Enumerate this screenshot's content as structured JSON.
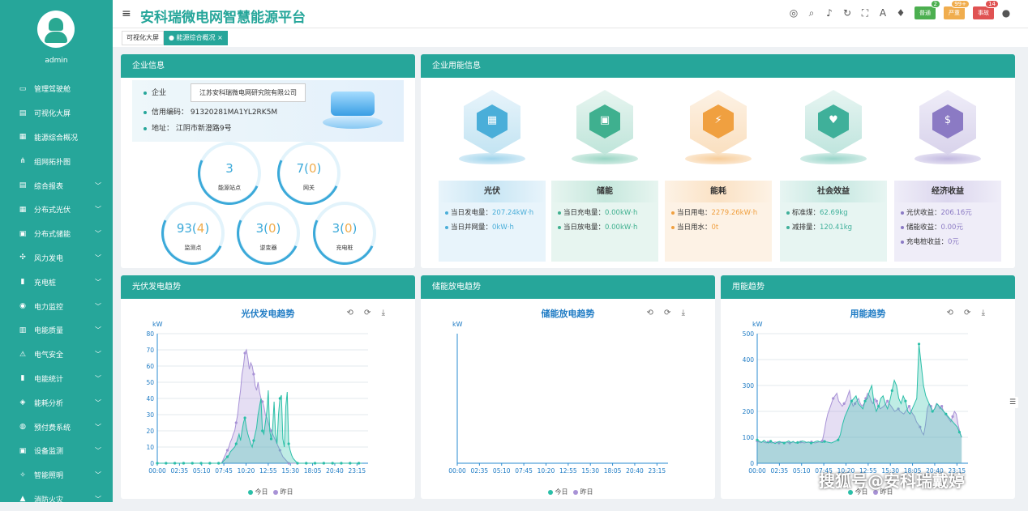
{
  "user": {
    "name": "admin"
  },
  "app": {
    "title": "安科瑞微电网智慧能源平台"
  },
  "menu": [
    {
      "label": "管理驾驶舱",
      "icon": "monitor-icon",
      "chev": false
    },
    {
      "label": "可视化大屏",
      "icon": "chart-icon",
      "chev": false
    },
    {
      "label": "能源综合概况",
      "icon": "grid-icon",
      "chev": false
    },
    {
      "label": "组网拓扑图",
      "icon": "topology-icon",
      "chev": false
    },
    {
      "label": "综合报表",
      "icon": "report-icon",
      "chev": true
    },
    {
      "label": "分布式光伏",
      "icon": "solar-icon",
      "chev": true
    },
    {
      "label": "分布式储能",
      "icon": "battery-icon",
      "chev": true
    },
    {
      "label": "风力发电",
      "icon": "wind-icon",
      "chev": true
    },
    {
      "label": "充电桩",
      "icon": "charger-icon",
      "chev": true
    },
    {
      "label": "电力监控",
      "icon": "power-icon",
      "chev": true
    },
    {
      "label": "电能质量",
      "icon": "quality-icon",
      "chev": true
    },
    {
      "label": "电气安全",
      "icon": "safety-icon",
      "chev": true
    },
    {
      "label": "电能统计",
      "icon": "stats-icon",
      "chev": true
    },
    {
      "label": "能耗分析",
      "icon": "analysis-icon",
      "chev": true
    },
    {
      "label": "预付费系统",
      "icon": "prepay-icon",
      "chev": true
    },
    {
      "label": "设备监测",
      "icon": "device-icon",
      "chev": true
    },
    {
      "label": "智能照明",
      "icon": "bulb-icon",
      "chev": true
    },
    {
      "label": "消防火灾",
      "icon": "fire-icon",
      "chev": true
    }
  ],
  "badges": [
    {
      "label": "普通",
      "count": "2",
      "color": "#4caf50"
    },
    {
      "label": "严重",
      "count": "99+",
      "color": "#f0ad4e"
    },
    {
      "label": "事故",
      "count": "14",
      "color": "#e05252"
    }
  ],
  "tabs": [
    {
      "label": "可视化大屏"
    },
    {
      "label": "● 能源综合概况 ×"
    }
  ],
  "enterprise": {
    "header": "企业信息",
    "company_label": "企业",
    "company": "江苏安科瑞微电网研究院有限公司",
    "credit": "信用编码：  91320281MA1YL2RK5M",
    "address": "地址：  江阴市新澄路9号",
    "stats": [
      {
        "value": "3",
        "extra": "",
        "label": "能源站点"
      },
      {
        "value": "7",
        "extra": "0",
        "label": "网关"
      },
      {
        "value": "93",
        "extra": "4",
        "label": "监测点"
      },
      {
        "value": "3",
        "extra": "0",
        "label": "逆变器"
      },
      {
        "value": "3",
        "extra": "0",
        "label": "充电桩"
      }
    ]
  },
  "energy_info": {
    "header": "企业用能信息",
    "cards": [
      {
        "title": "光伏",
        "color": "#4aaed9",
        "bg": "#e8f4fb",
        "rows": [
          {
            "k": "当日发电量：",
            "v": "207.24kW·h"
          },
          {
            "k": "当日并网量：",
            "v": "0kW·h"
          }
        ]
      },
      {
        "title": "储能",
        "color": "#3fb08f",
        "bg": "#e7f5f0",
        "rows": [
          {
            "k": "当日充电量：",
            "v": "0.00kW·h"
          },
          {
            "k": "当日放电量：",
            "v": "0.00kW·h"
          }
        ]
      },
      {
        "title": "能耗",
        "color": "#f0a040",
        "bg": "#fdf2e5",
        "rows": [
          {
            "k": "当日用电：",
            "v": "2279.26kW·h"
          },
          {
            "k": "当日用水：",
            "v": "0t"
          }
        ]
      },
      {
        "title": "社会效益",
        "color": "#3fb09a",
        "bg": "#e7f5f2",
        "rows": [
          {
            "k": "标准煤：",
            "v": "62.69kg"
          },
          {
            "k": "减排量：",
            "v": "120.41kg"
          }
        ]
      },
      {
        "title": "经济收益",
        "color": "#8b7ac4",
        "bg": "#efedf8",
        "rows": [
          {
            "k": "光伏收益：",
            "v": "206.16元"
          },
          {
            "k": "储能收益：",
            "v": "0.00元"
          },
          {
            "k": "充电桩收益：",
            "v": "0元"
          }
        ]
      }
    ]
  },
  "panels": {
    "pv": "光伏发电趋势",
    "es": "储能放电趋势",
    "use": "用能趋势"
  },
  "chart_tools": "⟲ ⟳ ⤓",
  "chart_data": [
    {
      "type": "area",
      "title": "光伏发电趋势",
      "ylabel": "kW",
      "ylim": [
        0,
        80
      ],
      "yticks": [
        0,
        10,
        20,
        30,
        40,
        50,
        60,
        70,
        80
      ],
      "xticks": [
        "00:00",
        "02:35",
        "05:10",
        "07:45",
        "10:20",
        "12:55",
        "15:30",
        "18:05",
        "20:40",
        "23:15"
      ],
      "series": [
        {
          "name": "今日",
          "color": "#2bbfa8",
          "values": [
            0,
            0,
            0,
            0,
            0,
            0,
            0,
            0,
            0,
            0,
            0,
            0,
            0,
            0,
            0,
            0,
            0,
            0,
            0,
            0,
            0,
            0,
            0,
            0,
            0,
            0,
            0,
            0,
            0,
            0,
            0,
            0,
            0,
            0,
            0,
            0,
            0,
            0,
            0,
            0,
            0,
            0,
            0,
            0,
            0,
            1,
            2,
            3,
            4,
            5,
            7,
            8,
            9,
            10,
            12,
            15,
            18,
            14,
            20,
            25,
            28,
            22,
            18,
            15,
            12,
            10,
            14,
            18,
            22,
            30,
            35,
            40,
            20,
            18,
            25,
            32,
            45,
            20,
            15,
            22,
            38,
            18,
            12,
            30,
            40,
            42,
            15,
            10,
            35,
            44,
            12,
            8,
            5,
            3,
            2,
            1,
            0,
            0,
            0,
            0,
            0,
            0,
            0,
            0,
            0,
            0,
            0,
            0,
            0,
            0,
            0,
            0,
            0,
            0,
            0,
            0,
            0,
            0,
            0,
            0,
            0,
            0,
            0,
            0,
            0,
            0,
            0,
            0,
            0,
            0,
            0,
            0,
            0,
            0,
            0,
            0,
            0,
            0,
            0,
            0,
            0
          ]
        },
        {
          "name": "昨日",
          "color": "#a892d6",
          "values": [
            0,
            0,
            0,
            0,
            0,
            0,
            0,
            0,
            0,
            0,
            0,
            0,
            0,
            0,
            0,
            0,
            0,
            0,
            0,
            0,
            0,
            0,
            0,
            0,
            0,
            0,
            0,
            0,
            0,
            0,
            0,
            0,
            0,
            0,
            0,
            0,
            0,
            0,
            0,
            0,
            0,
            0,
            0,
            0,
            0,
            2,
            4,
            6,
            8,
            10,
            13,
            15,
            18,
            20,
            25,
            30,
            38,
            45,
            55,
            60,
            68,
            70,
            65,
            58,
            62,
            60,
            55,
            48,
            45,
            50,
            44,
            40,
            38,
            35,
            30,
            28,
            25,
            22,
            20,
            18,
            16,
            14,
            12,
            10,
            8,
            6,
            4,
            3,
            2,
            1,
            0,
            0,
            0,
            0,
            0,
            0,
            0,
            0,
            0,
            0,
            0,
            0,
            0,
            0,
            0,
            0,
            0,
            0,
            0,
            0,
            0,
            0,
            0,
            0,
            0,
            0,
            0,
            0,
            0,
            0,
            0,
            0,
            0,
            0,
            0,
            0,
            0,
            0,
            0,
            0,
            0,
            0,
            0,
            0,
            0,
            0,
            0,
            0,
            0,
            0,
            0
          ]
        }
      ],
      "legend": [
        "今日",
        "昨日"
      ]
    },
    {
      "type": "line",
      "title": "储能放电趋势",
      "ylabel": "kW",
      "ylim": [
        0,
        1
      ],
      "yticks": [],
      "xticks": [
        "00:00",
        "02:35",
        "05:10",
        "07:45",
        "10:20",
        "12:55",
        "15:30",
        "18:05",
        "20:40",
        "23:15"
      ],
      "series": [],
      "legend": [
        "今日",
        "昨日"
      ]
    },
    {
      "type": "area",
      "title": "用能趋势",
      "ylabel": "kW",
      "ylim": [
        0,
        500
      ],
      "yticks": [
        0,
        100,
        200,
        300,
        400,
        500
      ],
      "xticks": [
        "00:00",
        "02:35",
        "05:10",
        "07:45",
        "10:20",
        "12:55",
        "15:30",
        "18:05",
        "20:40",
        "23:15"
      ],
      "series": [
        {
          "name": "今日",
          "color": "#2bbfa8",
          "values": [
            90,
            85,
            80,
            88,
            82,
            78,
            85,
            80,
            76,
            82,
            84,
            80,
            78,
            82,
            86,
            80,
            84,
            78,
            80,
            82,
            86,
            84,
            80,
            82,
            78,
            80,
            84,
            86,
            82,
            80,
            84,
            82,
            80,
            78,
            82,
            86,
            90,
            110,
            150,
            180,
            200,
            220,
            240,
            250,
            260,
            230,
            220,
            210,
            240,
            250,
            280,
            300,
            230,
            200,
            220,
            250,
            260,
            230,
            210,
            240,
            280,
            320,
            300,
            250,
            230,
            260,
            240,
            200,
            190,
            210,
            230,
            250,
            460,
            380,
            300,
            260,
            240,
            220,
            200,
            210,
            230,
            220,
            210,
            200,
            190,
            180,
            170,
            160,
            150,
            140,
            120,
            100
          ]
        },
        {
          "name": "昨日",
          "color": "#a892d6",
          "values": [
            85,
            82,
            80,
            84,
            80,
            78,
            82,
            80,
            78,
            80,
            82,
            80,
            78,
            80,
            82,
            80,
            82,
            80,
            78,
            80,
            82,
            80,
            78,
            80,
            82,
            80,
            78,
            80,
            82,
            80,
            82,
            80,
            78,
            80,
            82,
            84,
            86,
            120,
            160,
            190,
            210,
            230,
            250,
            260,
            270,
            240,
            230,
            220,
            230,
            240,
            260,
            280,
            240,
            220,
            230,
            240,
            250,
            230,
            220,
            230,
            250,
            270,
            260,
            240,
            230,
            250,
            240,
            220,
            210,
            215,
            220,
            230,
            240,
            230,
            220,
            210,
            200,
            205,
            210,
            200,
            195,
            190,
            200,
            210,
            220,
            200,
            190,
            180,
            160,
            150,
            140,
            120,
            110,
            150,
            210,
            230,
            220,
            200,
            210,
            230,
            225,
            210,
            220,
            200,
            190,
            180,
            170,
            160,
            180,
            200,
            190,
            150,
            120,
            100
          ]
        }
      ],
      "legend": [
        "今日",
        "昨日"
      ]
    }
  ],
  "watermark": "搜狐号@安科瑞戴婷"
}
